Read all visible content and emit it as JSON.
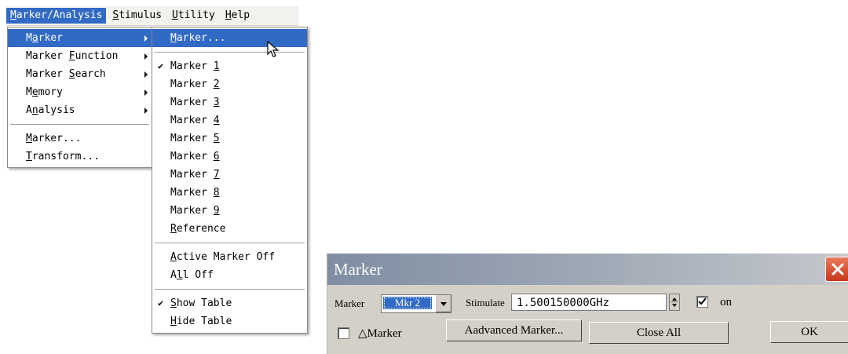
{
  "menubar": {
    "items": [
      {
        "label": "Marker/Analysis",
        "active": true
      },
      {
        "label": "Stimulus"
      },
      {
        "label": "Utility"
      },
      {
        "label": "Help"
      }
    ]
  },
  "menu_marker_analysis": {
    "items": [
      "Marker",
      "Marker Function",
      "Marker Search",
      "Memory",
      "Analysis"
    ],
    "extra": [
      "Marker...",
      "Transform..."
    ]
  },
  "menu_marker": {
    "header": "Marker...",
    "markers": [
      "Marker 1",
      "Marker 2",
      "Marker 3",
      "Marker 4",
      "Marker 5",
      "Marker 6",
      "Marker 7",
      "Marker 8",
      "Marker 9"
    ],
    "reference": "Reference",
    "active_off": "Active Marker Off",
    "all_off": "All Off",
    "show_table": "Show Table",
    "hide_table": "Hide Table",
    "checked": [
      "Marker 1",
      "Show Table"
    ]
  },
  "dialog": {
    "title": "Marker",
    "marker_label": "Marker",
    "marker_value": "Mkr 2",
    "stimulate_label": "Stimulate",
    "stimulate_value": "1.500150000GHz",
    "on_label": "on",
    "on_checked": true,
    "delta_label": "△Marker",
    "delta_checked": false,
    "advanced_button": "Aadvanced Marker...",
    "close_all_button": "Close All",
    "ok_button": "OK"
  },
  "colors": {
    "menu_highlight": "#316ac5",
    "dialog_bg": "#d4d0c8",
    "close_button": "#d8502e"
  }
}
